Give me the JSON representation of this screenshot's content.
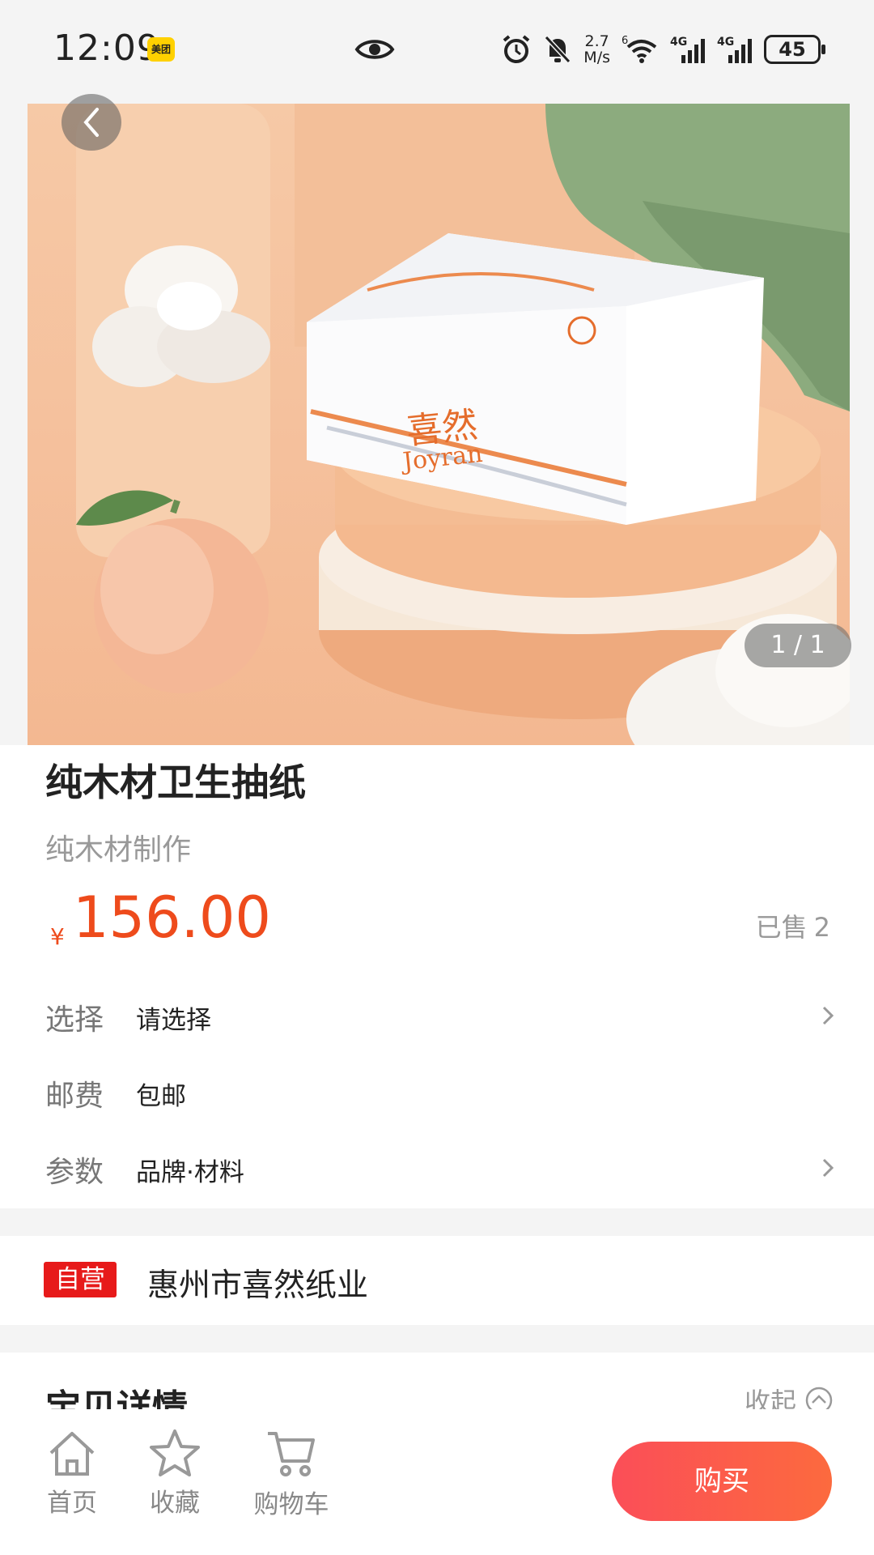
{
  "status_bar": {
    "time": "12:09",
    "app_badge": "美团",
    "net_speed_value": "2.7",
    "net_speed_unit": "M/s",
    "wifi_gen": "6",
    "sim1": "4G",
    "sim2": "4G",
    "battery": "45"
  },
  "gallery": {
    "indicator": "1 / 1",
    "package_brand": "喜然",
    "package_brand_en": "Joyran"
  },
  "product": {
    "title": "纯木材卫生抽纸",
    "subtitle": "纯木材制作",
    "currency": "¥",
    "price": "156.00",
    "sold_label": "已售",
    "sold_count": "2"
  },
  "options": [
    {
      "label": "选择",
      "value": "请选择"
    },
    {
      "label": "邮费",
      "value": "包邮"
    },
    {
      "label": "参数",
      "value": "品牌·材料"
    }
  ],
  "shop": {
    "badge": "自营",
    "name": "惠州市喜然纸业"
  },
  "details": {
    "title": "宝贝详情",
    "collapse_label": "收起"
  },
  "bottom_bar": {
    "home": "首页",
    "favorite": "收藏",
    "cart": "购物车",
    "buy": "购买"
  },
  "colors": {
    "accent": "#ee4b1c",
    "badge_red": "#e71a1a",
    "buy_gradient_start": "#fb4e58",
    "buy_gradient_end": "#fc6a3e"
  }
}
